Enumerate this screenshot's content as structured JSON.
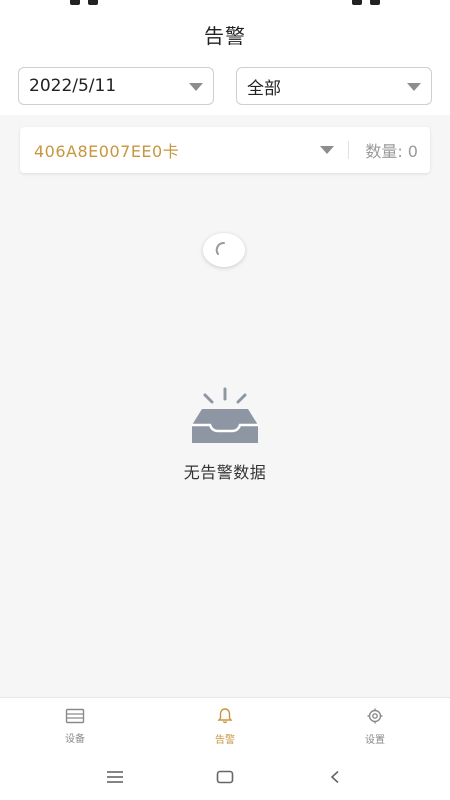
{
  "header": {
    "title": "告警"
  },
  "filters": {
    "date": {
      "value": "2022/5/11"
    },
    "type": {
      "value": "全部"
    }
  },
  "device_card": {
    "id": "406A8E007EE0卡",
    "count_label": "数量: 0"
  },
  "empty_state": {
    "icon": "inbox-empty-icon",
    "text": "无告警数据"
  },
  "bottom_nav": [
    {
      "label": "设备",
      "icon": "device-list-icon",
      "active": false
    },
    {
      "label": "告警",
      "icon": "bell-icon",
      "active": true
    },
    {
      "label": "设置",
      "icon": "gear-icon",
      "active": false
    }
  ],
  "system_nav": [
    {
      "icon": "menu-icon"
    },
    {
      "icon": "home-icon"
    },
    {
      "icon": "back-icon"
    }
  ],
  "colors": {
    "accent": "#c8963e",
    "muted": "#8a8a8a",
    "background": "#f6f6f7"
  }
}
